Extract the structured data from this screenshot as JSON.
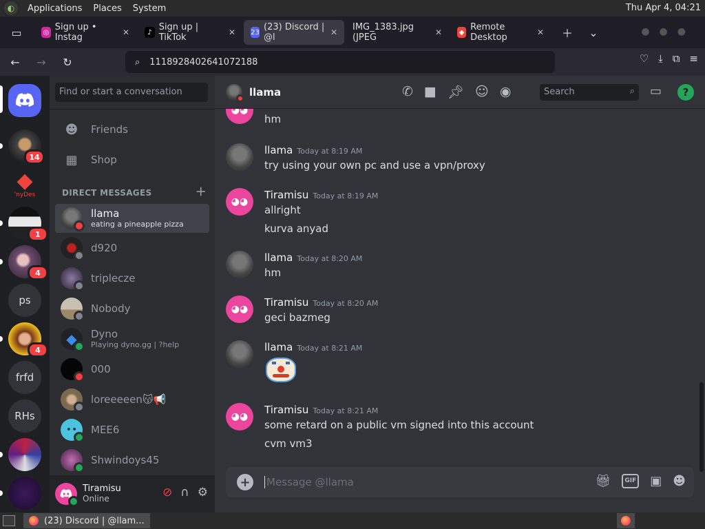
{
  "topbar": {
    "menus": [
      "Applications",
      "Places",
      "System"
    ],
    "clock": "Thu Apr  4, 04:21"
  },
  "tabs": [
    {
      "label": "Sign up • Instag",
      "icon": "instagram-icon",
      "color": "#d6249f"
    },
    {
      "label": "Sign up | TikTok",
      "icon": "tiktok-icon",
      "color": "#000000"
    },
    {
      "label": "(23) Discord | @l",
      "icon": "discord-icon",
      "color": "#5865f2",
      "active": true
    },
    {
      "label": "IMG_1383.jpg (JPEG",
      "icon": "",
      "color": ""
    },
    {
      "label": "Remote Desktop",
      "icon": "anydesk-icon",
      "color": "#ef443b"
    }
  ],
  "navbar": {
    "url": "1118928402641072188"
  },
  "servers": [
    {
      "name": "home",
      "label": "",
      "badge": ""
    },
    {
      "name": "server-avatar-1",
      "label": "",
      "badge": "14"
    },
    {
      "name": "anydesk",
      "label": "'nyDes",
      "badge": ""
    },
    {
      "name": "server-avatar-2",
      "label": "",
      "badge": "1"
    },
    {
      "name": "server-avatar-3",
      "label": "",
      "badge": "4"
    },
    {
      "name": "ps",
      "label": "ps",
      "badge": ""
    },
    {
      "name": "server-avatar-4",
      "label": "",
      "badge": "4"
    },
    {
      "name": "frfd",
      "label": "frfd",
      "badge": ""
    },
    {
      "name": "rhs",
      "label": "RHs",
      "badge": ""
    },
    {
      "name": "server-avatar-5",
      "label": "",
      "badge": ""
    },
    {
      "name": "server-avatar-6",
      "label": "",
      "badge": ""
    }
  ],
  "dms": {
    "search_placeholder": "Find or start a conversation",
    "friends": "Friends",
    "shop": "Shop",
    "header": "DIRECT MESSAGES",
    "items": [
      {
        "name": "llama",
        "sub": "eating a pineapple pizza",
        "status": "dnd",
        "selected": true
      },
      {
        "name": "d920",
        "sub": "",
        "status": "off"
      },
      {
        "name": "triplecze",
        "sub": "",
        "status": "off"
      },
      {
        "name": "Nobody",
        "sub": "",
        "status": "off"
      },
      {
        "name": "Dyno",
        "sub": "Playing dyno.gg | ?help",
        "status": "on"
      },
      {
        "name": "000",
        "sub": "",
        "status": "dnd"
      },
      {
        "name": "loreeeeen😽📢",
        "sub": "",
        "status": "off"
      },
      {
        "name": "MEE6",
        "sub": "",
        "status": "on"
      },
      {
        "name": "Shwindoys45",
        "sub": "",
        "status": "on"
      }
    ]
  },
  "user": {
    "name": "Tiramisu",
    "status": "Online"
  },
  "chat": {
    "channel": "llama",
    "search_placeholder": "Search",
    "composer_placeholder": "Message @llama",
    "messages": [
      {
        "author": "",
        "time": "",
        "lines": [
          "hm"
        ],
        "avatar": "discord"
      },
      {
        "author": "llama",
        "time": "Today at 8:19 AM",
        "lines": [
          "try using your own pc and use a vpn/proxy"
        ],
        "avatar": "llama"
      },
      {
        "author": "Tiramisu",
        "time": "Today at 8:19 AM",
        "lines": [
          "allright",
          "kurva anyad"
        ],
        "avatar": "discord"
      },
      {
        "author": "llama",
        "time": "Today at 8:20 AM",
        "lines": [
          "hm"
        ],
        "avatar": "llama"
      },
      {
        "author": "Tiramisu",
        "time": "Today at 8:20 AM",
        "lines": [
          "geci bazmeg"
        ],
        "avatar": "discord"
      },
      {
        "author": "llama",
        "time": "Today at 8:21 AM",
        "lines": [],
        "avatar": "llama",
        "emoji": "clown-face-emoji"
      },
      {
        "author": "Tiramisu",
        "time": "Today at 8:21 AM",
        "lines": [
          "some retard on a public vm signed into this account",
          "cvm vm3"
        ],
        "avatar": "discord"
      }
    ]
  },
  "taskbar": {
    "item": "(23) Discord | @llam..."
  },
  "colors": {
    "blurple": "#5865f2",
    "tiramisu_avatar": "#eb459e",
    "online": "#23a55a",
    "dnd": "#f23f43"
  }
}
